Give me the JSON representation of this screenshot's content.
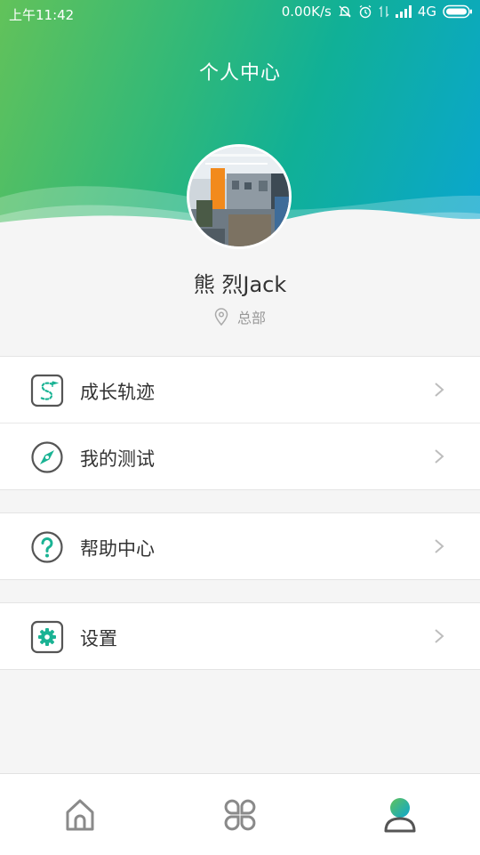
{
  "status_bar": {
    "time": "上午11:42",
    "net_speed": "0.00K/s",
    "network": "4G"
  },
  "header": {
    "title": "个人中心"
  },
  "profile": {
    "name": "熊 烈Jack",
    "location": "总部"
  },
  "menu": {
    "growth": {
      "label": "成长轨迹",
      "icon": "growth-path-icon"
    },
    "tests": {
      "label": "我的测试",
      "icon": "compass-icon"
    },
    "help": {
      "label": "帮助中心",
      "icon": "help-icon"
    },
    "settings": {
      "label": "设置",
      "icon": "gear-icon"
    }
  },
  "tabbar": {
    "tabs": [
      {
        "icon": "home-icon",
        "active": false
      },
      {
        "icon": "apps-icon",
        "active": false
      },
      {
        "icon": "profile-icon",
        "active": true
      }
    ]
  },
  "colors": {
    "accent": "#1ab394",
    "gradient_start": "#62c25a",
    "gradient_end": "#0aa6cf",
    "icon_gray": "#8a8a8a"
  }
}
